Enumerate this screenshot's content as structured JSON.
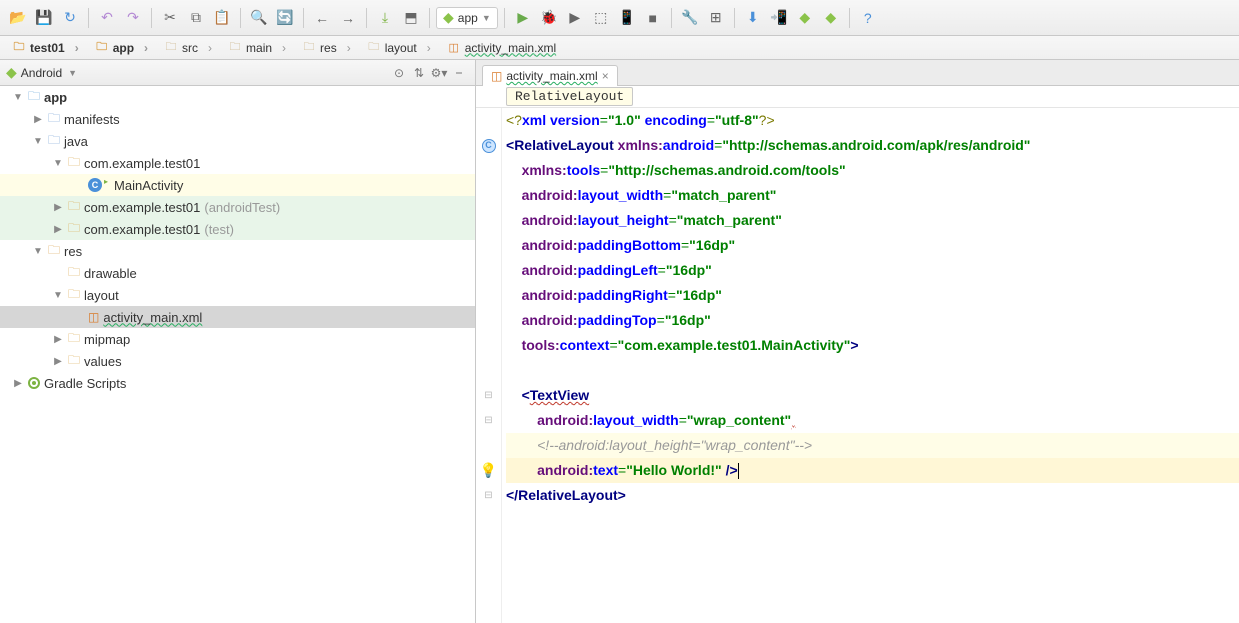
{
  "toolbar": {
    "config_label": "app"
  },
  "breadcrumb": [
    {
      "icon": "folder",
      "label": "test01",
      "bold": true
    },
    {
      "icon": "folder",
      "label": "app",
      "bold": true
    },
    {
      "icon": "folder-o",
      "label": "src"
    },
    {
      "icon": "folder-o",
      "label": "main"
    },
    {
      "icon": "folder-o",
      "label": "res"
    },
    {
      "icon": "folder-o",
      "label": "layout"
    },
    {
      "icon": "xml",
      "label": "activity_main.xml"
    }
  ],
  "project_panel": {
    "label": "Android"
  },
  "tree": {
    "app": "app",
    "manifests": "manifests",
    "java": "java",
    "pkg1": "com.example.test01",
    "main_activity": "MainActivity",
    "pkg2": "com.example.test01",
    "pkg2_suffix": " (androidTest)",
    "pkg3": "com.example.test01",
    "pkg3_suffix": " (test)",
    "res": "res",
    "drawable": "drawable",
    "layout": "layout",
    "activity_xml": "activity_main.xml",
    "mipmap": "mipmap",
    "values": "values",
    "gradle": "Gradle Scripts"
  },
  "editor": {
    "tab_label": "activity_main.xml",
    "nav_pill": "RelativeLayout"
  },
  "code": {
    "l1_a": "<?",
    "l1_b": "xml version",
    "l1_c": "=",
    "l1_d": "\"1.0\"",
    "l1_e": " encoding",
    "l1_f": "=",
    "l1_g": "\"utf-8\"",
    "l1_h": "?>",
    "l2_a": "<",
    "l2_b": "RelativeLayout ",
    "l2_c": "xmlns:",
    "l2_d": "android",
    "l2_e": "=",
    "l2_f": "\"http://schemas.android.com/apk/res/android\"",
    "l3_a": "xmlns:",
    "l3_b": "tools",
    "l3_c": "=",
    "l3_d": "\"http://schemas.android.com/tools\"",
    "l4_a": "android:",
    "l4_b": "layout_width",
    "l4_c": "=",
    "l4_d": "\"match_parent\"",
    "l5_a": "android:",
    "l5_b": "layout_height",
    "l5_c": "=",
    "l5_d": "\"match_parent\"",
    "l6_a": "android:",
    "l6_b": "paddingBottom",
    "l6_c": "=",
    "l6_d": "\"16dp\"",
    "l7_a": "android:",
    "l7_b": "paddingLeft",
    "l7_c": "=",
    "l7_d": "\"16dp\"",
    "l8_a": "android:",
    "l8_b": "paddingRight",
    "l8_c": "=",
    "l8_d": "\"16dp\"",
    "l9_a": "android:",
    "l9_b": "paddingTop",
    "l9_c": "=",
    "l9_d": "\"16dp\"",
    "l10_a": "tools:",
    "l10_b": "context",
    "l10_c": "=",
    "l10_d": "\"com.example.test01.MainActivity\"",
    "l10_e": ">",
    "l12_a": "<",
    "l12_b": "TextView",
    "l13_a": "android:",
    "l13_b": "layout_width",
    "l13_c": "=",
    "l13_d": "\"wrap_content\"",
    "l14": "<!--android:layout_height=\"wrap_content\"-->",
    "l15_a": "android:",
    "l15_b": "text",
    "l15_c": "=",
    "l15_d": "\"Hello World!\"",
    "l15_e": " />",
    "l16_a": "</",
    "l16_b": "RelativeLayout",
    "l16_c": ">"
  }
}
